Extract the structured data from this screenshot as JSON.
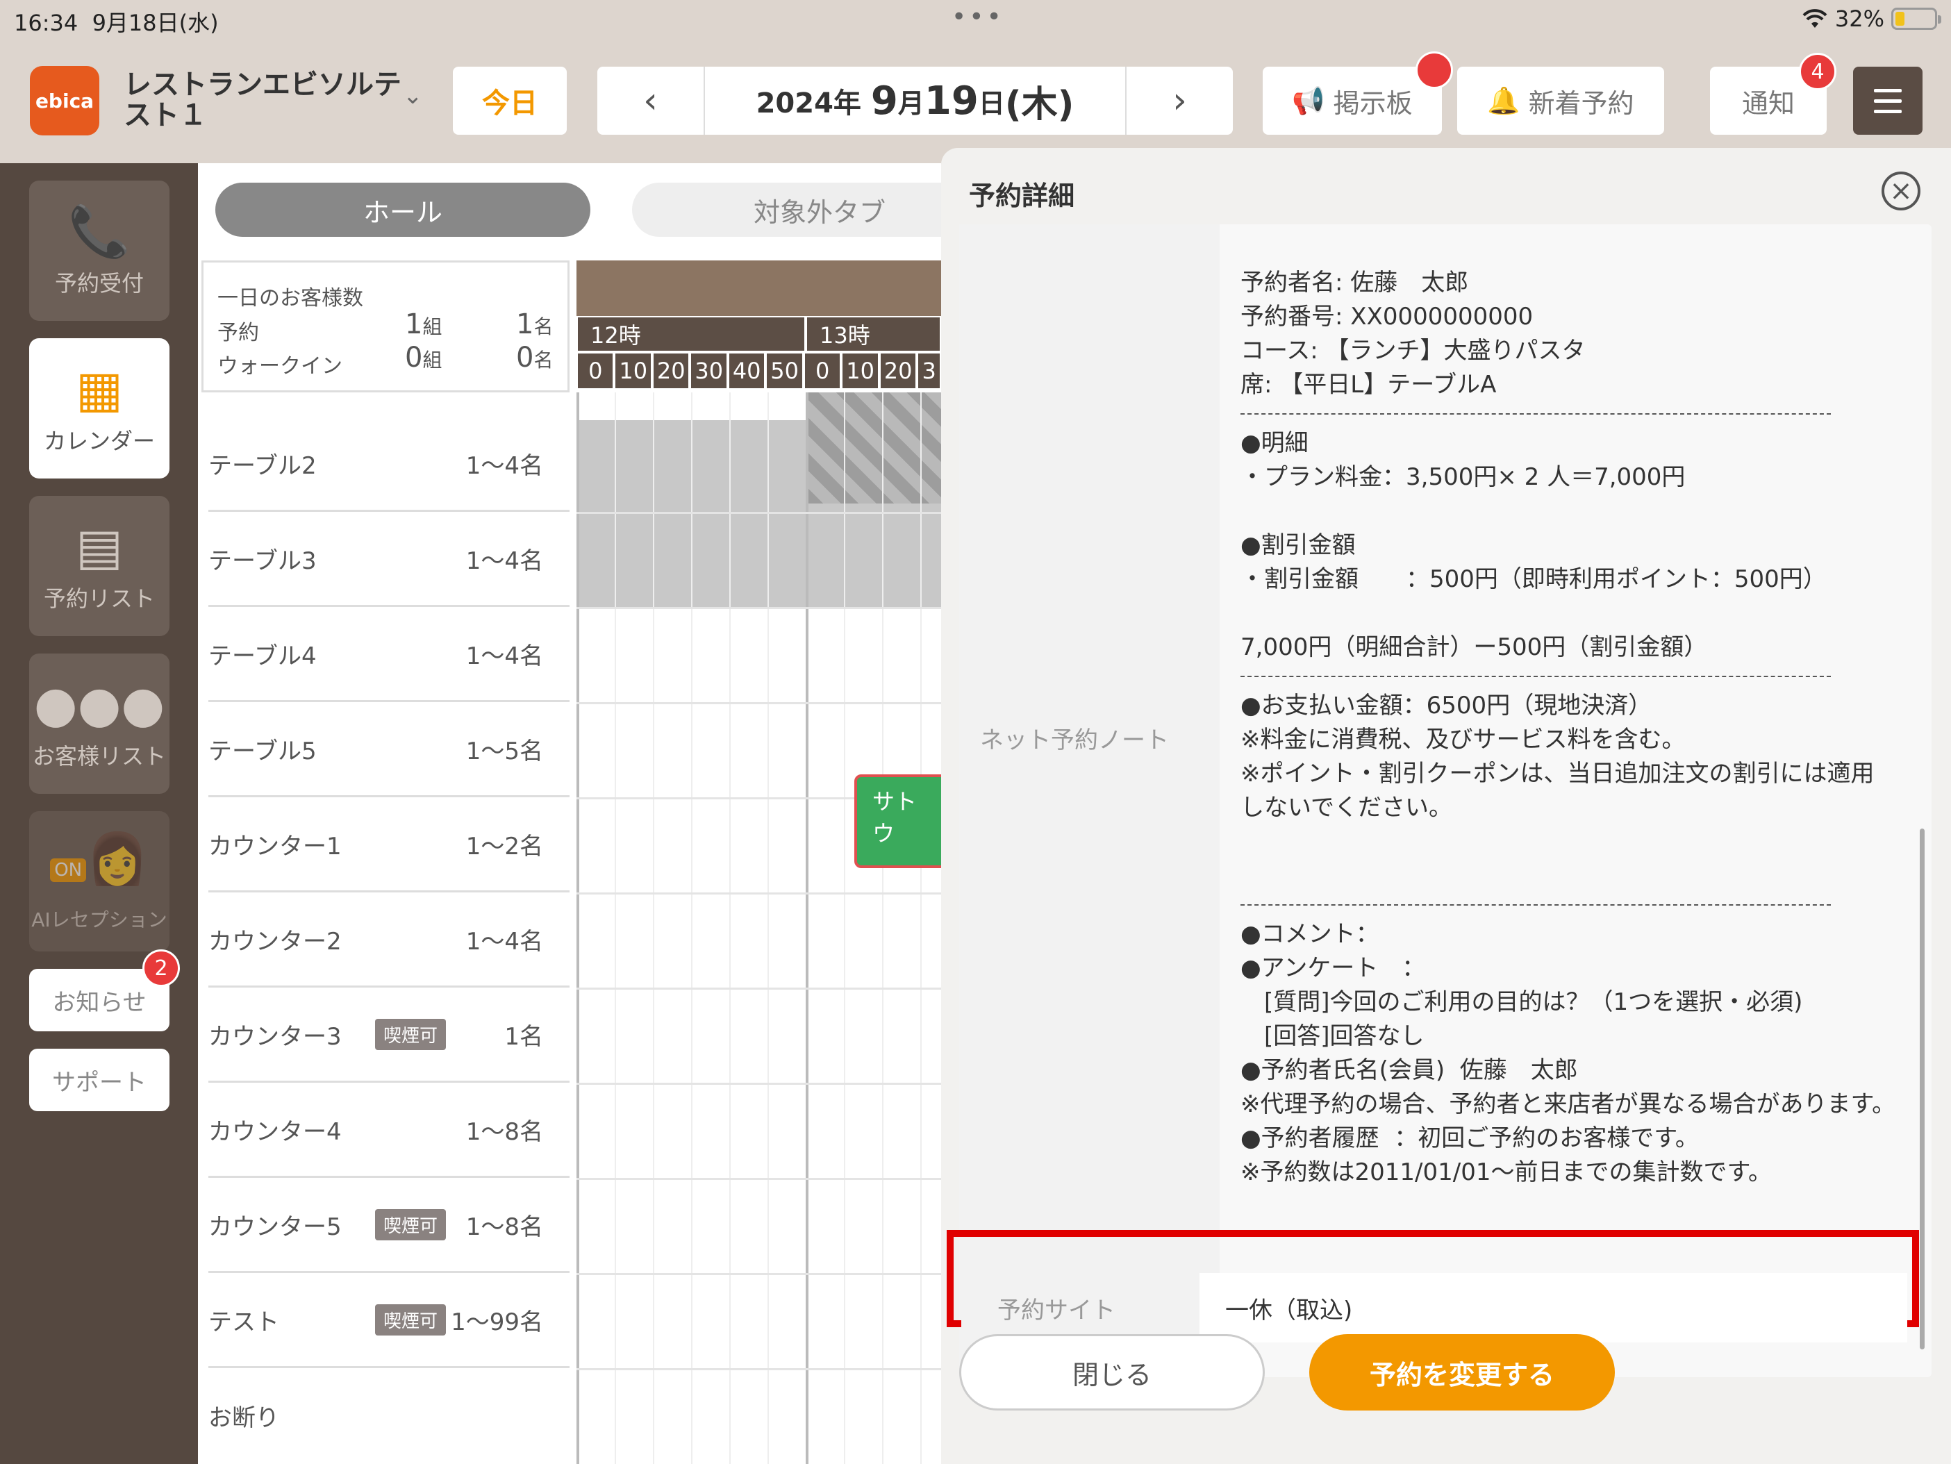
{
  "status": {
    "time": "16:34",
    "date": "9月18日(水)",
    "dots": "•••",
    "battery": "32%"
  },
  "header": {
    "logo": "ebica",
    "store_name": "レストランエビソルテスト１",
    "today": "今日",
    "date_year": "2024年",
    "date_month": "9",
    "date_month_unit": "月",
    "date_day": "19",
    "date_day_unit": "日",
    "date_weekday": "(木)",
    "board": "掲示板",
    "new_reservation": "新着予約",
    "notify": "通知",
    "notify_badge": "4"
  },
  "sidebar": {
    "items": [
      {
        "label": "予約受付",
        "icon": "phone-icon"
      },
      {
        "label": "カレンダー",
        "icon": "calendar-icon"
      },
      {
        "label": "予約リスト",
        "icon": "book-icon"
      },
      {
        "label": "お客様リスト",
        "icon": "users-icon"
      },
      {
        "label": "AIレセプション",
        "icon": "ai-reception-icon",
        "overlay": "ON"
      }
    ],
    "news": "お知らせ",
    "news_badge": "2",
    "support": "サポート"
  },
  "main": {
    "tab_hall": "ホール",
    "tab_other": "対象外タブ",
    "summary": {
      "title": "一日のお客様数",
      "reserve_label": "予約",
      "walkin_label": "ウォークイン",
      "reserve_groups": "1",
      "groups_unit": "組",
      "reserve_people": "1",
      "people_unit": "名",
      "walkin_groups": "0",
      "walkin_people": "0"
    },
    "hours": [
      "12時",
      "13時"
    ],
    "minutes": [
      "0",
      "10",
      "20",
      "30",
      "40",
      "50",
      "0",
      "10",
      "20",
      "3"
    ],
    "rows": [
      {
        "name": "テーブル2",
        "cap": "1～4名",
        "smoke": ""
      },
      {
        "name": "テーブル3",
        "cap": "1～4名",
        "smoke": ""
      },
      {
        "name": "テーブル4",
        "cap": "1～4名",
        "smoke": ""
      },
      {
        "name": "テーブル5",
        "cap": "1～5名",
        "smoke": ""
      },
      {
        "name": "カウンター1",
        "cap": "1～2名",
        "smoke": ""
      },
      {
        "name": "カウンター2",
        "cap": "1～4名",
        "smoke": ""
      },
      {
        "name": "カウンター3",
        "cap": "1名",
        "smoke": "喫煙可"
      },
      {
        "name": "カウンター4",
        "cap": "1～8名",
        "smoke": ""
      },
      {
        "name": "カウンター5",
        "cap": "1～8名",
        "smoke": "喫煙可"
      },
      {
        "name": "テスト",
        "cap": "1～99名",
        "smoke": "喫煙可"
      },
      {
        "name": "お断り",
        "cap": "",
        "smoke": ""
      }
    ],
    "reservation_block": "サトウ"
  },
  "panel": {
    "title": "予約詳細",
    "net_note_label": "ネット予約ノート",
    "notes": [
      "予約者名: 佐藤　太郎",
      "予約番号: XX0000000000",
      "コース: 【ランチ】大盛りパスタ",
      "席: 【平日L】テーブルA",
      "----",
      "●明細",
      "・プラン料金：3,500円× 2 人＝7,000円",
      "",
      "●割引金額",
      "・割引金額　　：500円（即時利用ポイント：500円）",
      "",
      "7,000円（明細合計）ー500円（割引金額）",
      "----",
      "●お支払い金額：6500円（現地決済）",
      "※料金に消費税、及びサービス料を含む。",
      "※ポイント・割引クーポンは、当日追加注文の割引には適用",
      "しないでください。",
      "",
      "",
      "----",
      "●コメント：",
      "●アンケート　：",
      "　[質問]今回のご利用の目的は？（1つを選択・必須)",
      "　[回答]回答なし",
      "●予約者氏名(会員)  佐藤　太郎",
      "※代理予約の場合、予約者と来店者が異なる場合があります。",
      "●予約者履歴  ：初回ご予約のお客様です。",
      "※予約数は2011/01/01～前日までの集計数です。"
    ],
    "site_label": "予約サイト",
    "site_value": "一休（取込)",
    "close": "閉じる",
    "change": "予約を変更する"
  }
}
